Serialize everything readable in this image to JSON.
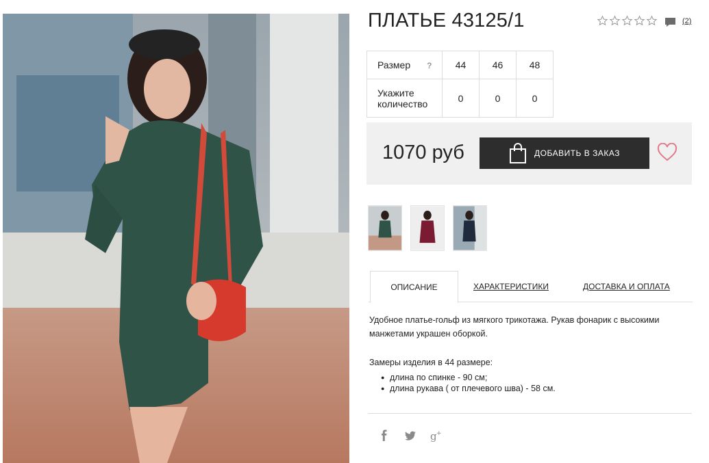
{
  "product": {
    "title": "ПЛАТЬЕ 43125/1",
    "rating_count": 0,
    "review_count": "(2)",
    "price": "1070 руб",
    "add_button_label": "ДОБАВИТЬ В ЗАКАЗ"
  },
  "sizes_table": {
    "size_label": "Размер",
    "help_label": "?",
    "sizes": [
      "44",
      "46",
      "48"
    ],
    "qty_label": "Укажите количество",
    "qty_values": [
      "0",
      "0",
      "0"
    ]
  },
  "thumbnails": [
    {
      "color": "#2f5346"
    },
    {
      "color": "#7a1b33"
    },
    {
      "color": "#1f2a3c"
    }
  ],
  "tabs": [
    {
      "label": "ОПИСАНИЕ",
      "active": true
    },
    {
      "label": "ХАРАКТЕРИСТИКИ",
      "active": false
    },
    {
      "label": "ДОСТАВКА И ОПЛАТА",
      "active": false
    }
  ],
  "description": {
    "text": "Удобное платье-гольф из мягкого трикотажа. Рукав фонарик с высокими манжетами украшен оборкой.",
    "measures_title": "Замеры изделия в 44 размере:",
    "measures": [
      "длина по спинке - 90 см;",
      "длина рукава ( от плечевого шва) - 58 см."
    ]
  },
  "social": [
    {
      "icon": "facebook-icon"
    },
    {
      "icon": "twitter-icon"
    },
    {
      "icon": "google-plus-icon"
    }
  ],
  "colors": {
    "button_bg": "#2d2d2d",
    "price_box_bg": "#f0f0f0",
    "heart": "#e07a8a",
    "dress": "#2f5346"
  }
}
